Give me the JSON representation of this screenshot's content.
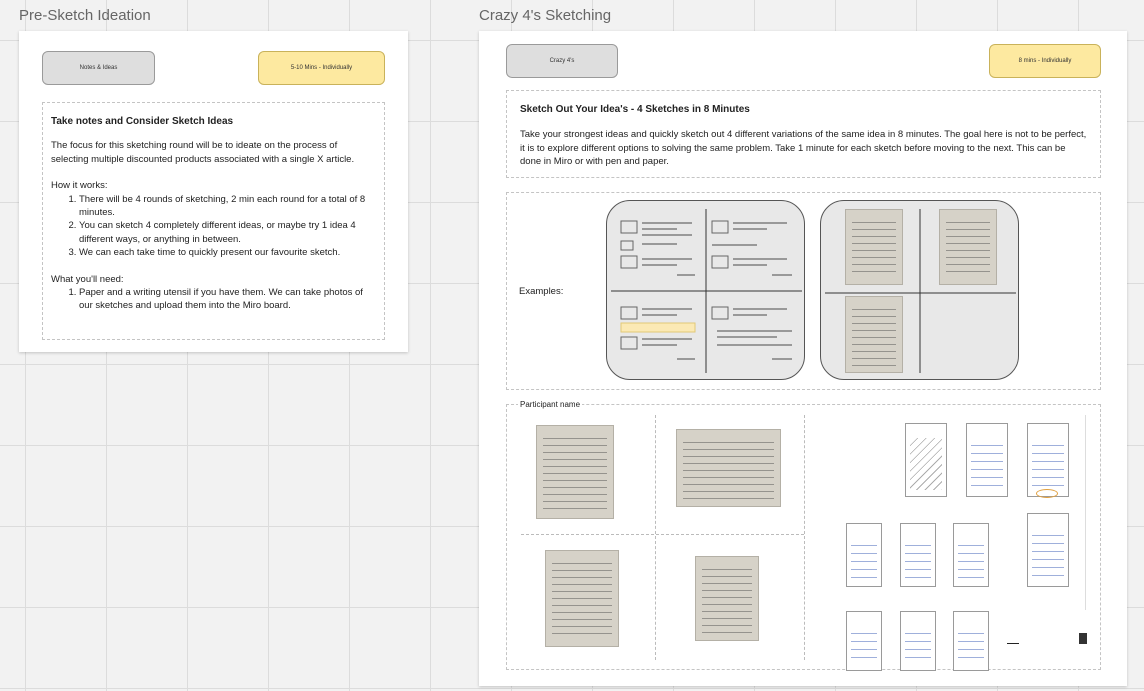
{
  "left_frame": {
    "title": "Pre-Sketch Ideation",
    "sticky_gray": "Notes & Ideas",
    "sticky_yellow": "5-10 Mins - Individually",
    "notes_title": "Take notes and Consider Sketch Ideas",
    "intro": "The focus for this sketching round will be to ideate on the process of selecting multiple discounted products associated with a single X article.",
    "how_heading": "How it works:",
    "how_items": [
      "There will be 4 rounds of sketching, 2 min each round for a total of 8 minutes.",
      "You can sketch 4 completely different ideas, or maybe try 1 idea 4 different ways, or anything in between.",
      "We can each take time to quickly present our favourite sketch."
    ],
    "need_heading": "What you'll need:",
    "need_items": [
      "Paper and a writing utensil if you have them. We can take photos of our sketches and upload them into the Miro board."
    ]
  },
  "right_frame": {
    "title": "Crazy 4's Sketching",
    "sticky_gray": "Crazy 4's",
    "sticky_yellow": "8 mins - Individually",
    "heading": "Sketch Out Your Idea's - 4 Sketches in 8 Minutes",
    "body": "Take your strongest ideas and quickly sketch out 4 different variations of the same idea in 8 minutes. The goal here is not to be perfect, it is to explore different options to solving the same problem. Take 1 minute for each sketch before moving to the next. This can be done in Miro or with pen and paper.",
    "examples_label": "Examples:",
    "participant_label": "Participant name"
  }
}
